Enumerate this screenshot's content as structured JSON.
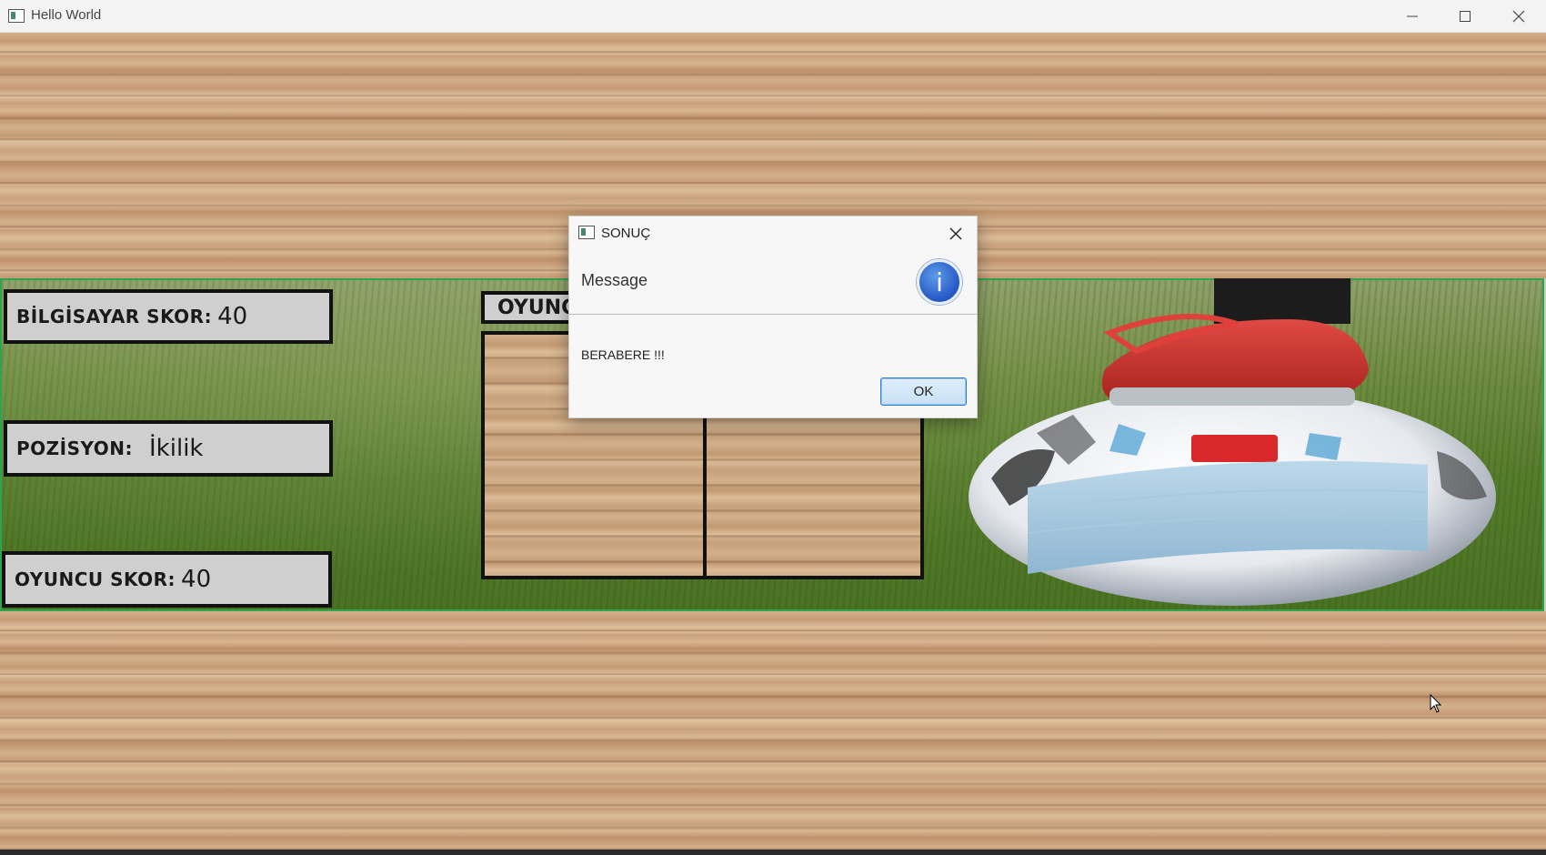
{
  "window": {
    "title": "Hello World",
    "minimize_icon": "minimize-icon",
    "maximize_icon": "maximize-icon",
    "close_icon": "close-icon"
  },
  "scores": {
    "computer_label": "BİLGİSAYAR SKOR:",
    "computer_value": "40",
    "position_label": "POZİSYON:",
    "position_value": "İkilik",
    "player_label": "OYUNCU SKOR:",
    "player_value": "40"
  },
  "game_panel": {
    "header_label": "OYUNC"
  },
  "dialog": {
    "title": "SONUÇ",
    "header": "Message",
    "message": "BERABERE !!!",
    "ok_label": "OK",
    "info_glyph": "i"
  },
  "colors": {
    "field_border": "#2ea44f",
    "ok_border": "#2b7bd1",
    "info_icon": "#2458c4"
  }
}
